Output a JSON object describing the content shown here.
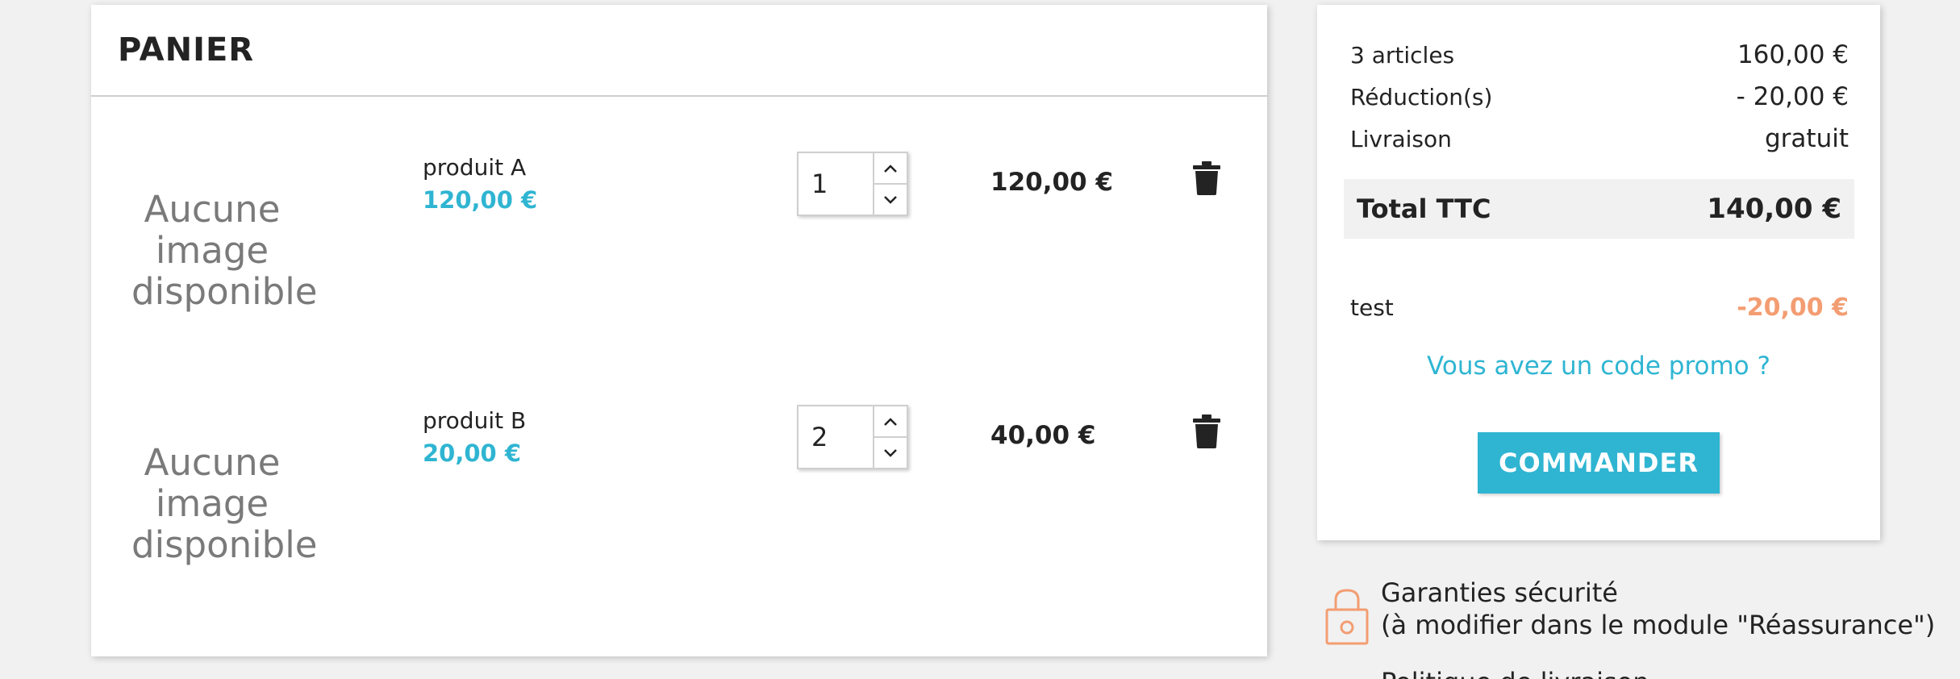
{
  "cart": {
    "title": "PANIER",
    "items": [
      {
        "image_placeholder": "Aucune image disponible",
        "name": "produit A",
        "unit_price": "120,00 €",
        "quantity": "1",
        "line_total": "120,00 €"
      },
      {
        "image_placeholder": "Aucune image disponible",
        "name": "produit B",
        "unit_price": "20,00 €",
        "quantity": "2",
        "line_total": "40,00 €"
      }
    ]
  },
  "summary": {
    "articles_label": "3 articles",
    "articles_value": "160,00 €",
    "reduction_label": "Réduction(s)",
    "reduction_value": "- 20,00 €",
    "shipping_label": "Livraison",
    "shipping_value": "gratuit",
    "total_label": "Total TTC",
    "total_value": "140,00 €",
    "voucher_name": "test",
    "voucher_value": "-20,00 €",
    "promo_link": "Vous avez un code promo ?",
    "checkout_label": "COMMANDER"
  },
  "reassurance": {
    "title": "Garanties sécurité",
    "subtitle": "(à modifier dans le module \"Réassurance\")",
    "next_item": "Politique de livraison"
  },
  "colors": {
    "accent": "#2fb5d2",
    "discount": "#f39d72",
    "lock_icon": "#f39d72"
  },
  "icons": {
    "delete": "trash-icon",
    "qty_up": "chevron-up-icon",
    "qty_down": "chevron-down-icon",
    "reassurance": "lock-icon"
  }
}
